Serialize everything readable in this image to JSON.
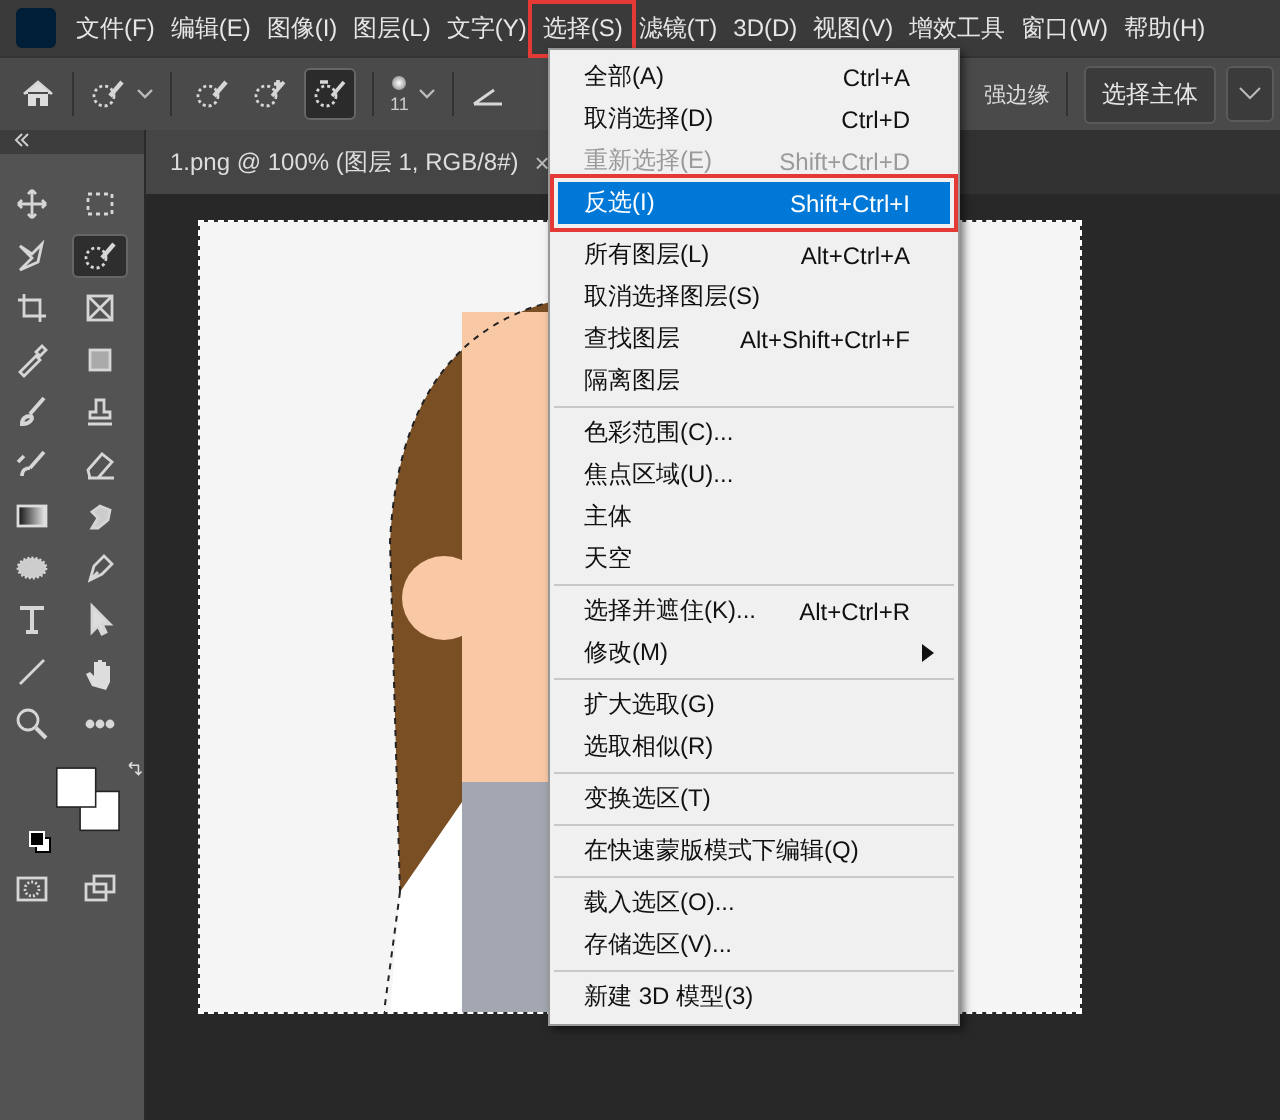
{
  "menu_bar": {
    "items": [
      {
        "label": "文件(F)",
        "open": false
      },
      {
        "label": "编辑(E)",
        "open": false
      },
      {
        "label": "图像(I)",
        "open": false
      },
      {
        "label": "图层(L)",
        "open": false
      },
      {
        "label": "文字(Y)",
        "open": false
      },
      {
        "label": "选择(S)",
        "open": true
      },
      {
        "label": "滤镜(T)",
        "open": false
      },
      {
        "label": "3D(D)",
        "open": false
      },
      {
        "label": "视图(V)",
        "open": false
      },
      {
        "label": "增效工具",
        "open": false
      },
      {
        "label": "窗口(W)",
        "open": false
      },
      {
        "label": "帮助(H)",
        "open": false
      }
    ]
  },
  "options_bar": {
    "brush_size": "11",
    "modes": [
      {
        "selected": false
      },
      {
        "selected": false
      },
      {
        "selected": true
      }
    ],
    "edge_label": "强边缘",
    "subject_button": "选择主体"
  },
  "tools": [
    {
      "selected": false
    },
    {
      "selected": false
    },
    {
      "selected": false
    },
    {
      "selected": true
    },
    {
      "selected": false
    },
    {
      "selected": false
    },
    {
      "selected": false
    },
    {
      "selected": false
    },
    {
      "selected": false
    },
    {
      "selected": false
    },
    {
      "selected": false
    },
    {
      "selected": false
    },
    {
      "selected": false
    },
    {
      "selected": false
    },
    {
      "selected": false
    },
    {
      "selected": false
    },
    {
      "selected": false
    },
    {
      "selected": false
    },
    {
      "selected": false
    },
    {
      "selected": false
    },
    {
      "selected": false
    },
    {
      "selected": false
    },
    {
      "selected": false
    },
    {
      "selected": false
    }
  ],
  "document_tab": {
    "title": "1.png @ 100% (图层 1, RGB/8#)",
    "close": "×"
  },
  "select_menu": {
    "groups": [
      [
        {
          "label": "全部(A)",
          "shortcut": "Ctrl+A",
          "disabled": false,
          "selected": false
        },
        {
          "label": "取消选择(D)",
          "shortcut": "Ctrl+D",
          "disabled": false,
          "selected": false
        },
        {
          "label": "重新选择(E)",
          "shortcut": "Shift+Ctrl+D",
          "disabled": true,
          "selected": false
        },
        {
          "label": "反选(I)",
          "shortcut": "Shift+Ctrl+I",
          "disabled": false,
          "selected": true
        }
      ],
      [
        {
          "label": "所有图层(L)",
          "shortcut": "Alt+Ctrl+A",
          "disabled": false,
          "selected": false
        },
        {
          "label": "取消选择图层(S)",
          "disabled": false,
          "selected": false
        },
        {
          "label": "查找图层",
          "shortcut": "Alt+Shift+Ctrl+F",
          "disabled": false,
          "selected": false
        },
        {
          "label": "隔离图层",
          "disabled": false,
          "selected": false
        }
      ],
      [
        {
          "label": "色彩范围(C)...",
          "disabled": false,
          "selected": false
        },
        {
          "label": "焦点区域(U)...",
          "disabled": false,
          "selected": false
        },
        {
          "label": "主体",
          "disabled": false,
          "selected": false
        },
        {
          "label": "天空",
          "disabled": false,
          "selected": false
        }
      ],
      [
        {
          "label": "选择并遮住(K)...",
          "shortcut": "Alt+Ctrl+R",
          "disabled": false,
          "selected": false
        },
        {
          "label": "修改(M)",
          "submenu": true,
          "disabled": false,
          "selected": false
        }
      ],
      [
        {
          "label": "扩大选取(G)",
          "disabled": false,
          "selected": false
        },
        {
          "label": "选取相似(R)",
          "disabled": false,
          "selected": false
        }
      ],
      [
        {
          "label": "变换选区(T)",
          "disabled": false,
          "selected": false
        }
      ],
      [
        {
          "label": "在快速蒙版模式下编辑(Q)",
          "disabled": false,
          "selected": false
        }
      ],
      [
        {
          "label": "载入选区(O)...",
          "disabled": false,
          "selected": false
        },
        {
          "label": "存储选区(V)...",
          "disabled": false,
          "selected": false
        }
      ],
      [
        {
          "label": "新建 3D 模型(3)",
          "disabled": false,
          "selected": false
        }
      ]
    ]
  }
}
